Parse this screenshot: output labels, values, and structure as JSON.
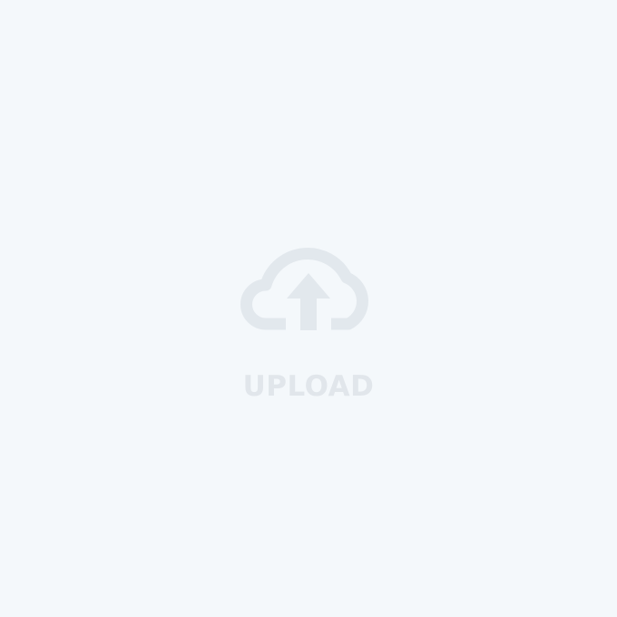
{
  "upload": {
    "label": "UPLOAD",
    "icon": "cloud-upload-icon"
  },
  "colors": {
    "background": "#f4f8fb",
    "icon": "#e2e8ed",
    "label": "#e1e6eb"
  }
}
